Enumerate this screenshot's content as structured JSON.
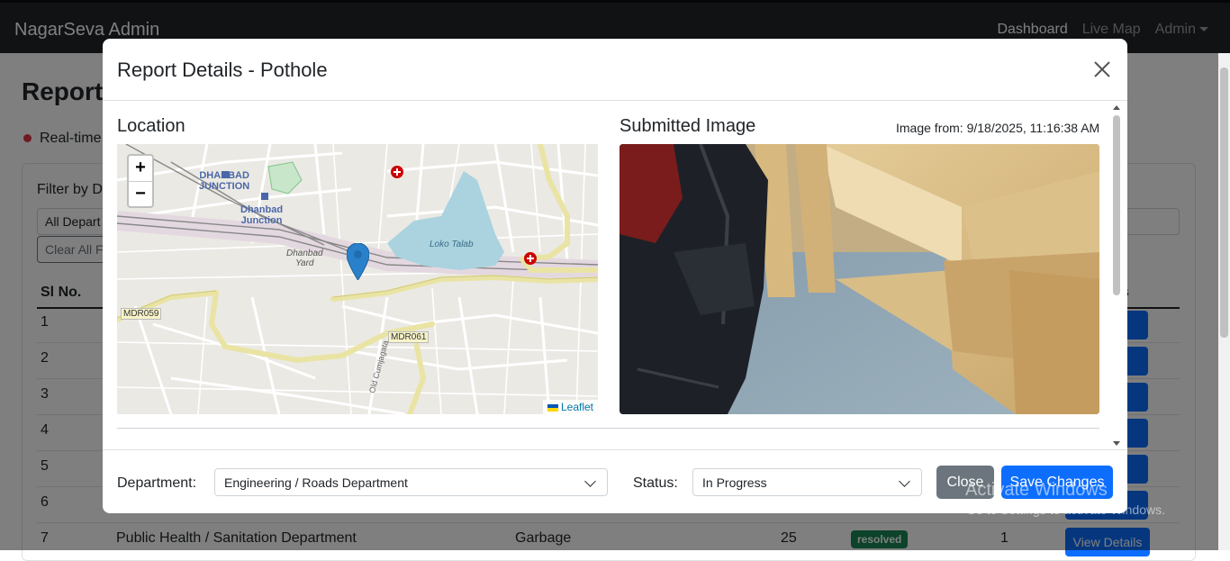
{
  "navbar": {
    "brand": "NagarSeva Admin",
    "links": [
      "Dashboard",
      "Live Map",
      "Admin"
    ]
  },
  "page": {
    "title": "Reports",
    "realtime": "Real-time",
    "filter_label": "Filter by D",
    "dept_filter_value": "All Depart",
    "clear_button": "Clear All Fi",
    "col_sl": "Sl No.",
    "col_actions": "s",
    "row_numbers": [
      "1",
      "2",
      "3",
      "4",
      "5",
      "6",
      "7"
    ],
    "view_button": "Details",
    "last_row": {
      "sl": "7",
      "department": "Public Health / Sanitation Department",
      "category": "Garbage",
      "votes": "25",
      "status": "resolved",
      "count": "1",
      "action": "View Details"
    }
  },
  "modal": {
    "title": "Report Details - Pothole",
    "location_heading": "Location",
    "image_heading": "Submitted Image",
    "image_meta": "Image from: 9/18/2025, 11:16:38 AM",
    "map": {
      "zoom_in": "+",
      "zoom_out": "−",
      "attribution": "Leaflet",
      "labels": {
        "station1": "DHANBAD",
        "station1b": "JUNCTION",
        "station2": "Dhanbad",
        "station2b": "Junction",
        "yard": "Dhanbad",
        "yard2": "Yard",
        "lake": "Loko Talab",
        "road1": "MDR059",
        "road2": "MDR061",
        "street": "Old Cumjagata"
      }
    },
    "footer": {
      "department_label": "Department:",
      "department_value": "Engineering / Roads Department",
      "status_label": "Status:",
      "status_value": "In Progress",
      "close_button": "Close",
      "save_button": "Save Changes"
    }
  },
  "watermark": {
    "line1": "Activate Windows",
    "line2": "Go to Settings to activate Windows."
  },
  "colors": {
    "navbar_bg": "#212529",
    "primary": "#0d6efd",
    "secondary": "#6c757d",
    "success": "#198754",
    "danger": "#dc3545"
  }
}
